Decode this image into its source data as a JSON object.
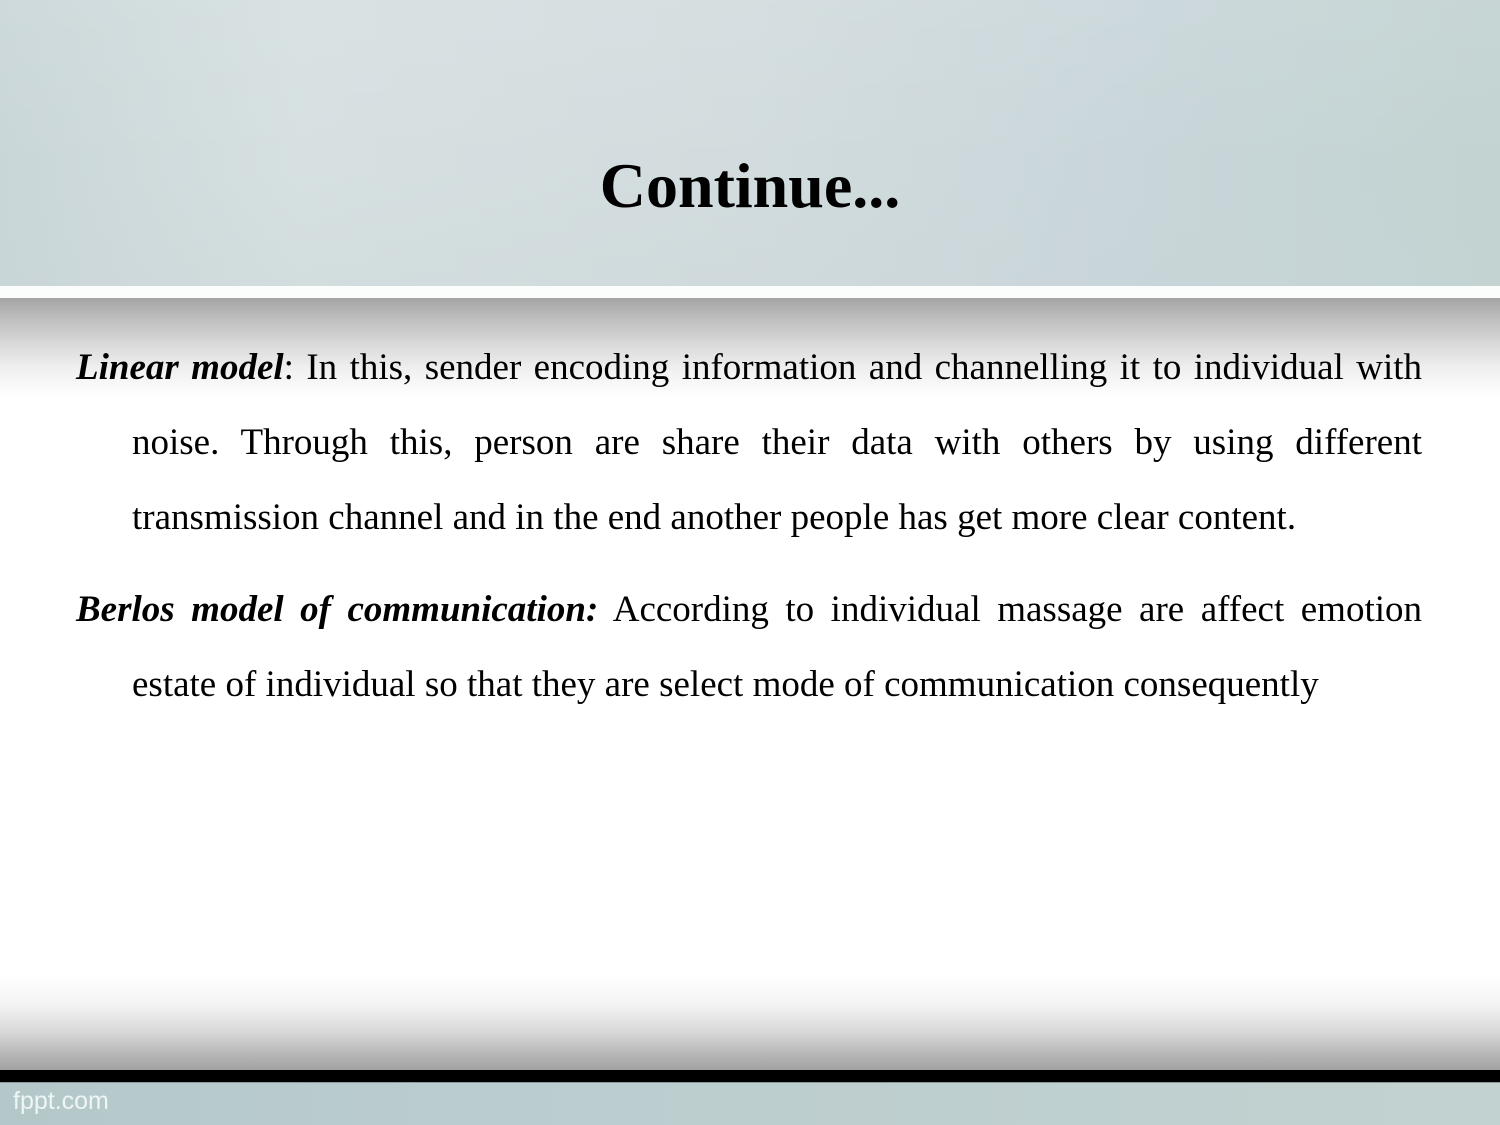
{
  "slide": {
    "title": "Continue...",
    "paragraphs": [
      {
        "term": "Linear model",
        "separator": ":",
        "text": " In this, sender encoding information and channelling it to individual with noise. Through this, person are share their data with others by using different transmission channel and in the end another people has get more clear content."
      },
      {
        "term": "Berlos model of communication:",
        "separator": "",
        "text": " According to individual massage are affect emotion estate of individual so that they are select mode of communication consequently"
      }
    ]
  },
  "footer": {
    "brand": "fppt.com"
  },
  "colors": {
    "header_band": "#d2dcde",
    "footer_band": "#bccdcf",
    "bar": "#000000",
    "text": "#000000",
    "footer_text": "#eef5f5"
  }
}
